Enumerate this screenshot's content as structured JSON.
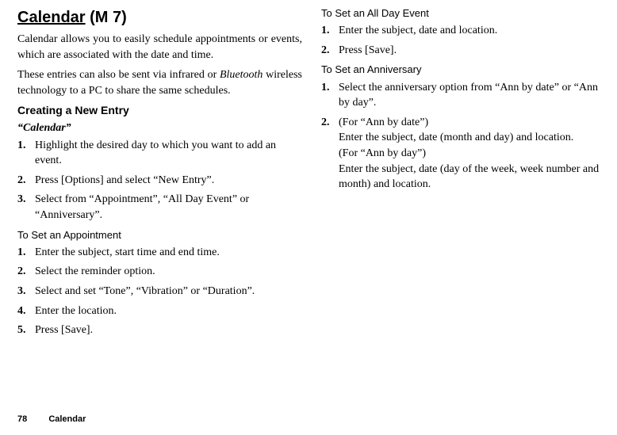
{
  "left": {
    "title_main": "Calendar",
    "title_suffix": " (M 7)",
    "para1": "Calendar allows you to easily schedule appointments or events, which are associated with the date and time.",
    "para2_a": "These entries can also be sent via infrared or ",
    "para2_i": "Bluetooth",
    "para2_b": " wireless technology to a PC to share the same schedules.",
    "h_create": "Creating a New Entry",
    "i_calendar": "“Calendar”",
    "create_steps": [
      "Highlight the desired day to which you want to add an event.",
      "Press [Options] and select “New Entry”.",
      "Select from “Appointment”, “All Day Event” or “Anniversary”."
    ],
    "h_appt": "To Set an Appointment",
    "appt_steps": [
      "Enter the subject, start time and end time.",
      "Select the reminder option.",
      "Select and set “Tone”, “Vibration” or “Duration”.",
      "Enter the location.",
      "Press [Save]."
    ]
  },
  "right": {
    "h_allday": "To Set an All Day Event",
    "allday_steps": [
      "Enter the subject, date and location.",
      "Press [Save]."
    ],
    "h_anniv": "To Set an Anniversary",
    "anniv_step1": "Select the anniversary option from “Ann by date” or “Ann by day”.",
    "anniv_step2_a": "(For “Ann by date”)",
    "anniv_step2_b": "Enter the subject, date (month and day) and location.",
    "anniv_step2_c": "(For “Ann by day”)",
    "anniv_step2_d": "Enter the subject, date (day of the week, week number and month) and location."
  },
  "footer": {
    "page": "78",
    "section": "Calendar"
  }
}
